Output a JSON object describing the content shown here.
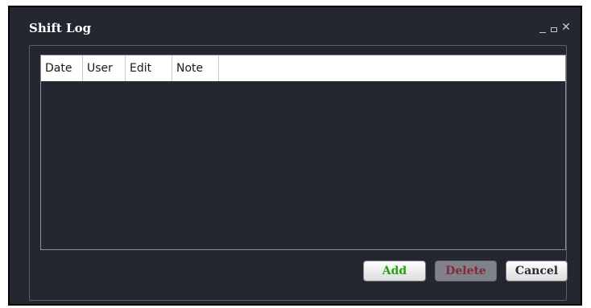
{
  "window": {
    "title": "Shift Log",
    "close_glyph": "✕"
  },
  "grid": {
    "columns": [
      "Date",
      "User",
      "Edit",
      "Note"
    ],
    "rows": []
  },
  "buttons": {
    "add_label": "Add",
    "delete_label": "Delete",
    "cancel_label": "Cancel"
  },
  "colors": {
    "window_bg": "#242730",
    "add_text": "#27a018",
    "delete_text": "#8b2535",
    "delete_bg": "#7f828a"
  },
  "icons": {
    "minimize": "minimize-icon",
    "maximize": "maximize-icon",
    "close": "close-icon"
  }
}
